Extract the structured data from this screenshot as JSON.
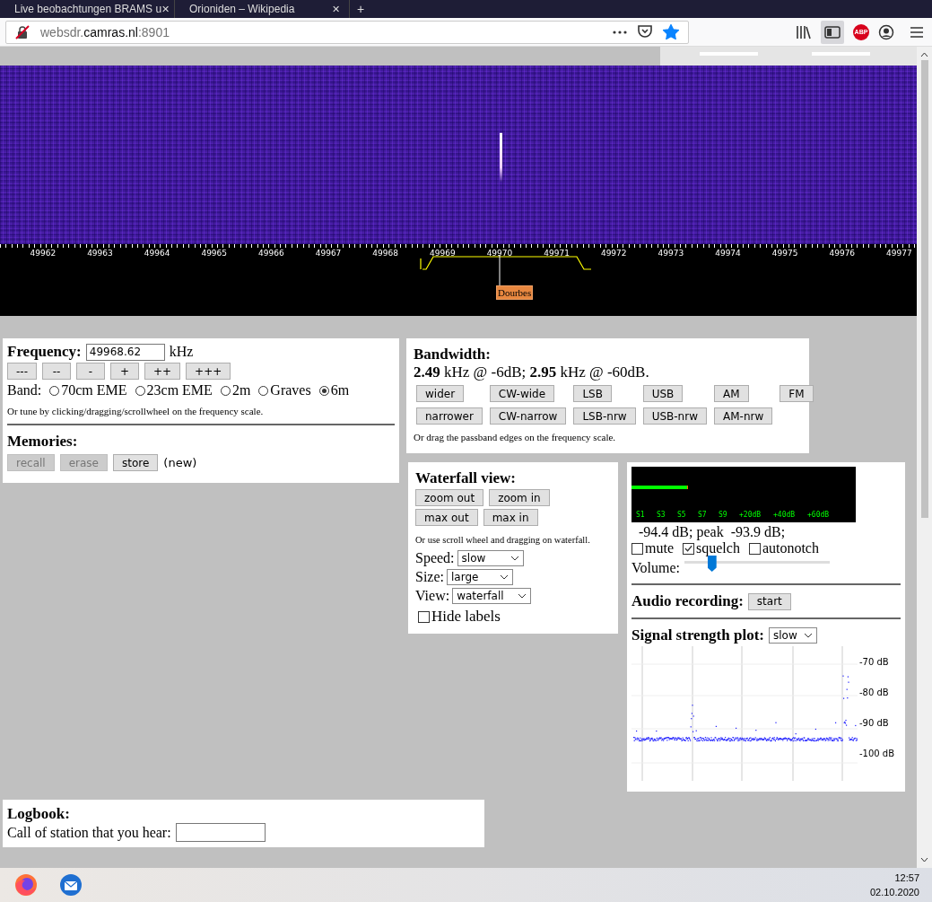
{
  "browser": {
    "tabs": [
      {
        "title": "Live beobachtungen BRAMS u",
        "close": "✕"
      },
      {
        "title": "Orioniden – Wikipedia",
        "close": "✕"
      }
    ],
    "new_tab": "+",
    "url": {
      "prefix": "websdr.",
      "domain": "camras.nl",
      "suffix": ":8901"
    },
    "bookmarked": true,
    "sidebar_on": true,
    "adblock_label": "ABP"
  },
  "waterfall": {
    "scale": [
      "49962",
      "49963",
      "49964",
      "49965",
      "49966",
      "49967",
      "49968",
      "49969",
      "49970",
      "49971",
      "49972",
      "49973",
      "49974",
      "49975",
      "49976",
      "49977"
    ],
    "marker_label": "Dourbes"
  },
  "frequency": {
    "label": "Frequency:",
    "value": "49968.62",
    "unit": "kHz",
    "steps": [
      "---",
      "--",
      "-",
      "+",
      "++",
      "+++"
    ],
    "band_label": "Band:",
    "bands": [
      {
        "label": "70cm EME",
        "selected": false
      },
      {
        "label": "23cm EME",
        "selected": false
      },
      {
        "label": "2m",
        "selected": false
      },
      {
        "label": "Graves",
        "selected": false
      },
      {
        "label": "6m",
        "selected": true
      }
    ],
    "hint": "Or tune by clicking/dragging/scrollwheel on the frequency scale."
  },
  "memories": {
    "title": "Memories:",
    "buttons": [
      {
        "label": "recall",
        "disabled": true
      },
      {
        "label": "erase",
        "disabled": true
      },
      {
        "label": "store",
        "disabled": false
      }
    ],
    "note": "(new)"
  },
  "bandwidth": {
    "title": "Bandwidth:",
    "summary": "**2.49** kHz @ -6dB; **2.95** kHz @ -60dB.",
    "buttons_row1": [
      "wider",
      "CW-wide",
      "LSB",
      "USB",
      "AM",
      "FM"
    ],
    "buttons_row2": [
      "narrower",
      "CW-narrow",
      "LSB-nrw",
      "USB-nrw",
      "AM-nrw"
    ],
    "hint": "Or drag the passband edges on the frequency scale."
  },
  "waterfall_view": {
    "title": "Waterfall view:",
    "zoom_buttons": [
      "zoom out",
      "zoom in"
    ],
    "max_buttons": [
      "max out",
      "max in"
    ],
    "hint": "Or use scroll wheel and dragging on waterfall.",
    "selects": [
      {
        "label": "Speed:",
        "value": "slow"
      },
      {
        "label": "Size:",
        "value": "large"
      },
      {
        "label": "View:",
        "value": "waterfall"
      }
    ],
    "hide_labels": {
      "label": "Hide labels",
      "checked": false
    }
  },
  "audio": {
    "smeter": {
      "level": 0.25,
      "scale": [
        "S1",
        "S3",
        "S5",
        "S7",
        "S9",
        "+20dB",
        "+40dB",
        "+60dB"
      ]
    },
    "reading": "-94.4 dB; peak  -93.9 dB;",
    "options": [
      {
        "label": "mute",
        "checked": false
      },
      {
        "label": "squelch",
        "checked": true
      },
      {
        "label": "autonotch",
        "checked": false
      }
    ],
    "volume": {
      "label": "Volume:",
      "level": 0.19
    },
    "recording": {
      "title": "Audio recording:",
      "button": "start"
    },
    "plot": {
      "title": "Signal strength plot:",
      "speed": "slow",
      "y_labels": [
        "-70 dB",
        "-80 dB",
        "-90 dB",
        "-100 dB"
      ]
    }
  },
  "logbook": {
    "title": "Logbook:",
    "call_label": "Call of station that you hear:"
  },
  "taskbar": {
    "time": "12:57",
    "date": "02.10.2020"
  }
}
